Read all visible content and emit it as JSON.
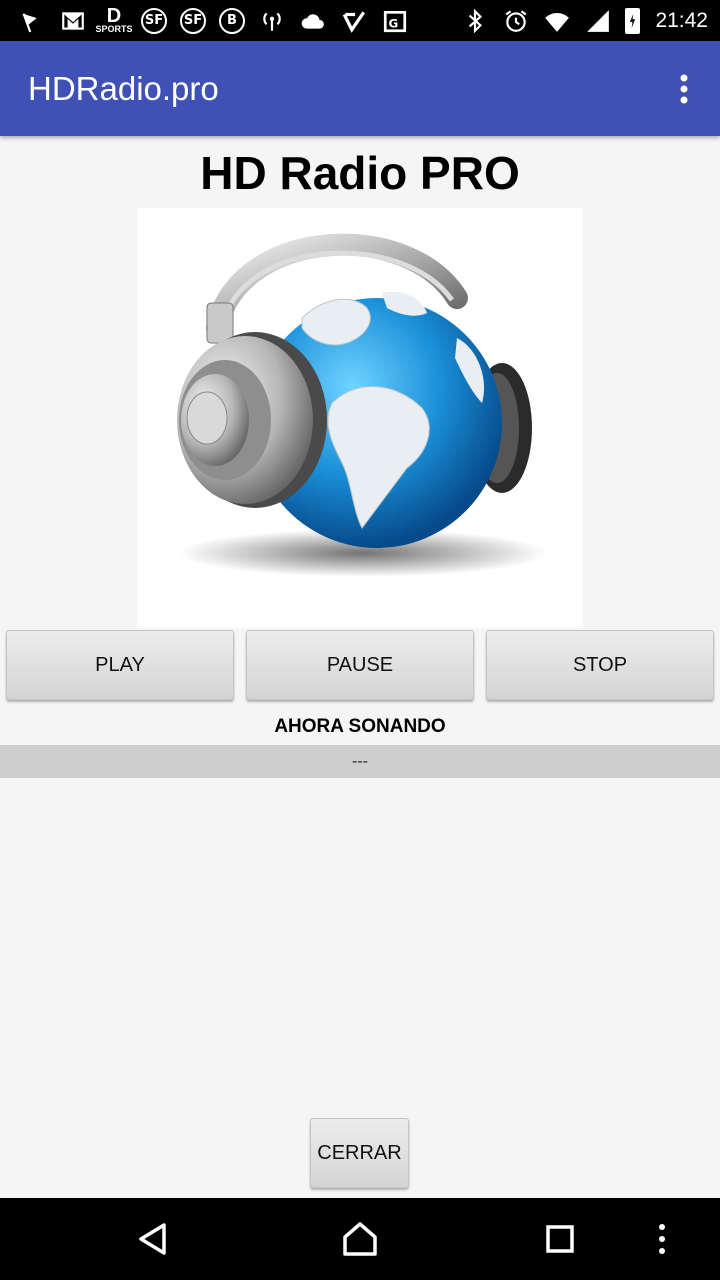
{
  "status_bar": {
    "time": "21:42",
    "icons": [
      "flag-icon",
      "gmail-icon",
      "d-sports-icon",
      "sf-icon",
      "sf-icon",
      "b-icon",
      "hotspot-icon",
      "cloud-icon",
      "check-icon",
      "maps-icon",
      "bluetooth-icon",
      "alarm-icon",
      "wifi-icon",
      "signal-icon",
      "battery-icon"
    ],
    "sports_label": "SPORTS",
    "sf_label": "SF",
    "b_label": "B"
  },
  "app_bar": {
    "title": "HDRadio.pro",
    "overflow_icon": "more-vert-icon",
    "color": "#3f51b5"
  },
  "main": {
    "title": "HD Radio PRO",
    "image": "headphones-globe-image",
    "buttons": {
      "play": "PLAY",
      "pause": "PAUSE",
      "stop": "STOP"
    },
    "now_playing_label": "AHORA SONANDO",
    "now_playing_value": "---",
    "close_button": "CERRAR"
  },
  "nav_bar": {
    "icons": [
      "back-icon",
      "home-icon",
      "recents-icon",
      "menu-icon"
    ]
  }
}
